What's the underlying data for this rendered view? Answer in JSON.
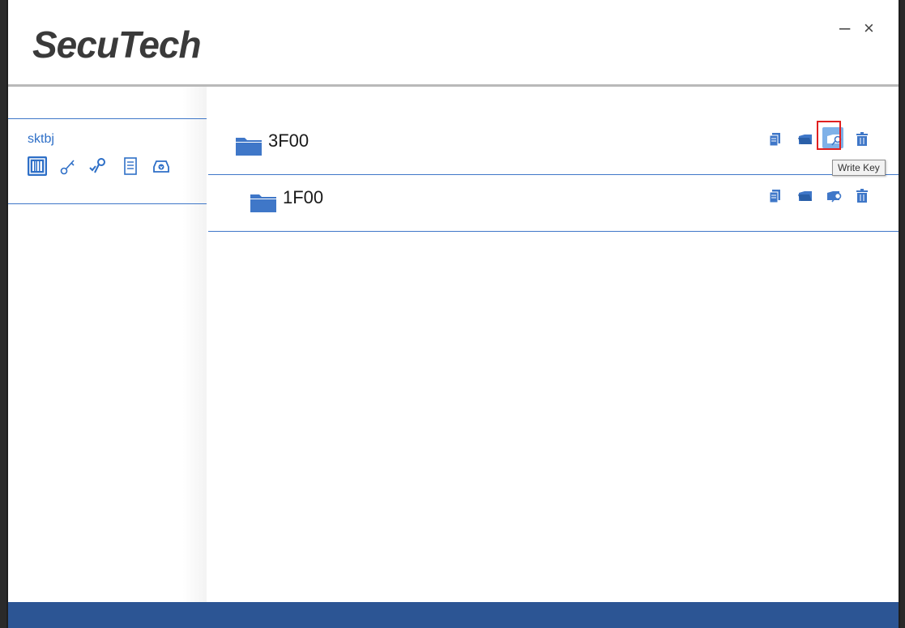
{
  "header": {
    "logo": "SecuTech",
    "minimize_label": "–",
    "close_label": "×"
  },
  "sidebar": {
    "account": "sktbj",
    "tools": [
      {
        "icon": "barcode-icon",
        "active": true
      },
      {
        "icon": "key-icon"
      },
      {
        "icon": "key-check-icon"
      },
      {
        "icon": "document-icon"
      },
      {
        "icon": "download-tray-icon"
      }
    ]
  },
  "folders": [
    {
      "name": "3F00",
      "actions": [
        "copy-icon",
        "folder-open-icon",
        "write-key-icon",
        "trash-icon"
      ]
    },
    {
      "name": "1F00",
      "actions": [
        "copy-icon",
        "folder-open-icon",
        "write-key-icon",
        "trash-icon"
      ]
    }
  ],
  "tooltip": "Write Key",
  "colors": {
    "accent": "#2e6fc7",
    "footer": "#2c5594",
    "highlight": "#e02020",
    "folder": "#3f77c8"
  }
}
